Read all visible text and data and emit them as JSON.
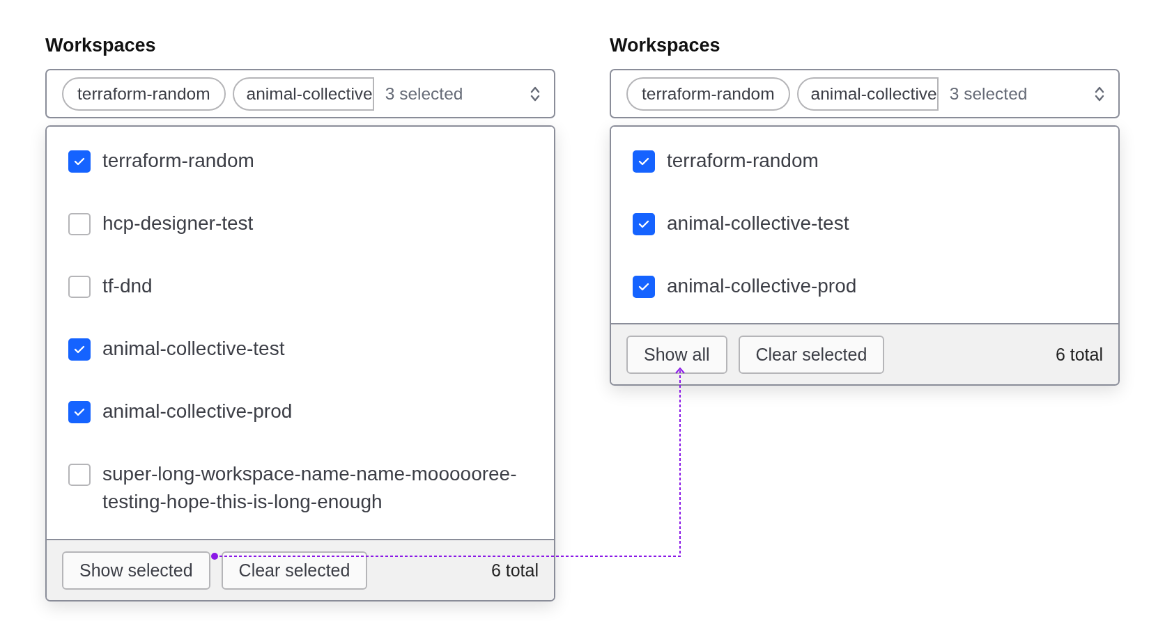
{
  "panels": [
    {
      "title": "Workspaces",
      "chips": [
        "terraform-random",
        "animal-collective"
      ],
      "summary": "3 selected",
      "options": [
        {
          "label": "terraform-random",
          "checked": true
        },
        {
          "label": "hcp-designer-test",
          "checked": false
        },
        {
          "label": "tf-dnd",
          "checked": false
        },
        {
          "label": "animal-collective-test",
          "checked": true
        },
        {
          "label": "animal-collective-prod",
          "checked": true
        },
        {
          "label": "super-long-workspace-name-name-moooooree-testing-hope-this-is-long-enough",
          "checked": false
        }
      ],
      "buttons": [
        "Show selected",
        "Clear selected"
      ],
      "total": "6 total"
    },
    {
      "title": "Workspaces",
      "chips": [
        "terraform-random",
        "animal-collective"
      ],
      "summary": "3 selected",
      "options": [
        {
          "label": "terraform-random",
          "checked": true
        },
        {
          "label": "animal-collective-test",
          "checked": true
        },
        {
          "label": "animal-collective-prod",
          "checked": true
        }
      ],
      "buttons": [
        "Show all",
        "Clear selected"
      ],
      "total": "6 total"
    }
  ]
}
